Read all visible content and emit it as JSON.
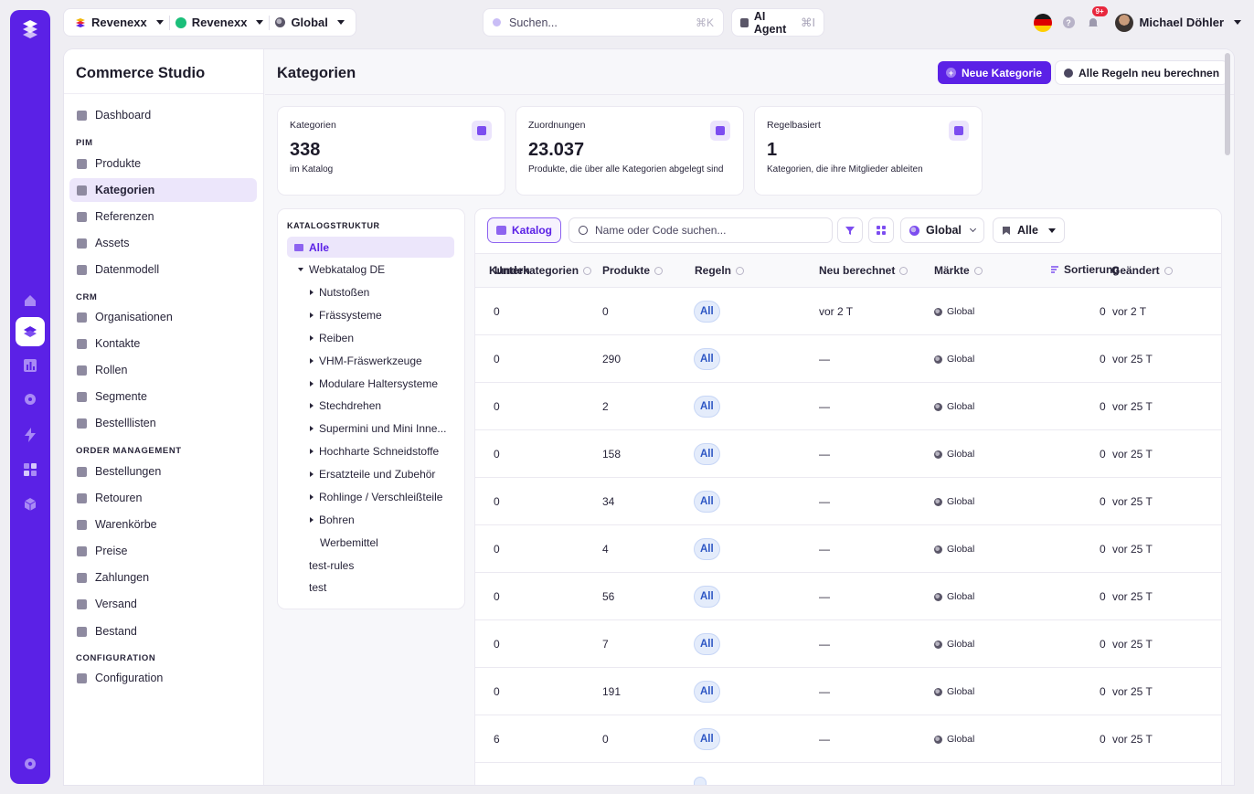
{
  "topbar": {
    "org1": "Revenexx",
    "org2": "Revenexx",
    "scope": "Global",
    "search_placeholder": "Suchen...",
    "search_shortcut": "⌘K",
    "agent_label": "AI Agent",
    "agent_shortcut": "⌘I",
    "notif_count": "9+",
    "user_name": "Michael Döhler"
  },
  "sidebar": {
    "title": "Commerce Studio",
    "dashboard": "Dashboard",
    "sections": {
      "pim": "PIM",
      "crm": "CRM",
      "order": "ORDER MANAGEMENT",
      "config": "CONFIGURATION"
    },
    "items": {
      "produkte": "Produkte",
      "kategorien": "Kategorien",
      "referenzen": "Referenzen",
      "assets": "Assets",
      "datenmodell": "Datenmodell",
      "organisationen": "Organisationen",
      "kontakte": "Kontakte",
      "rollen": "Rollen",
      "segmente": "Segmente",
      "bestelllisten": "Bestelllisten",
      "bestellungen": "Bestellungen",
      "retouren": "Retouren",
      "warenkoerbe": "Warenkörbe",
      "preise": "Preise",
      "zahlungen": "Zahlungen",
      "versand": "Versand",
      "bestand": "Bestand",
      "configuration": "Configuration"
    }
  },
  "page": {
    "title": "Kategorien",
    "new_button": "Neue Kategorie",
    "recalc_button": "Alle Regeln neu berechnen"
  },
  "stats": [
    {
      "label": "Kategorien",
      "value": "338",
      "sub": "im Katalog"
    },
    {
      "label": "Zuordnungen",
      "value": "23.037",
      "sub": "Produkte, die über alle Kategorien abgelegt sind"
    },
    {
      "label": "Regelbasiert",
      "value": "1",
      "sub": "Kategorien, die ihre Mitglieder ableiten"
    }
  ],
  "tree": {
    "heading": "KATALOGSTRUKTUR",
    "all": "Alle",
    "root": "Webkatalog DE",
    "children": [
      "Nutstoßen",
      "Frässysteme",
      "Reiben",
      "VHM-Fräswerkzeuge",
      "Modulare Haltersysteme",
      "Stechdrehen",
      "Supermini und Mini Inne...",
      "Hochharte Schneidstoffe",
      "Ersatzteile und Zubehör",
      "Rohlinge / Verschleißteile",
      "Bohren",
      "Werbemittel"
    ],
    "others": [
      "test-rules",
      "test"
    ]
  },
  "toolbar": {
    "tab": "Katalog",
    "search_placeholder": "Name oder Code suchen...",
    "market": "Global",
    "filter": "Alle"
  },
  "table": {
    "headers": {
      "col1a": "Kunden",
      "col1b": "Unterkategorien",
      "produkte": "Produkte",
      "regeln": "Regeln",
      "neu": "Neu berechnet",
      "maerkte": "Märkte",
      "sortierung": "Sortierung",
      "geaendert": "Geändert"
    },
    "rows": [
      {
        "sub": "0",
        "produkte": "0",
        "regeln": "All",
        "neu": "vor 2 T",
        "markt": "Global",
        "sort": "0",
        "geaendert": "vor 2 T"
      },
      {
        "sub": "0",
        "produkte": "290",
        "regeln": "All",
        "neu": "—",
        "markt": "Global",
        "sort": "0",
        "geaendert": "vor 25 T"
      },
      {
        "sub": "0",
        "produkte": "2",
        "regeln": "All",
        "neu": "—",
        "markt": "Global",
        "sort": "0",
        "geaendert": "vor 25 T"
      },
      {
        "sub": "0",
        "produkte": "158",
        "regeln": "All",
        "neu": "—",
        "markt": "Global",
        "sort": "0",
        "geaendert": "vor 25 T"
      },
      {
        "sub": "0",
        "produkte": "34",
        "regeln": "All",
        "neu": "—",
        "markt": "Global",
        "sort": "0",
        "geaendert": "vor 25 T"
      },
      {
        "sub": "0",
        "produkte": "4",
        "regeln": "All",
        "neu": "—",
        "markt": "Global",
        "sort": "0",
        "geaendert": "vor 25 T"
      },
      {
        "sub": "0",
        "produkte": "56",
        "regeln": "All",
        "neu": "—",
        "markt": "Global",
        "sort": "0",
        "geaendert": "vor 25 T"
      },
      {
        "sub": "0",
        "produkte": "7",
        "regeln": "All",
        "neu": "—",
        "markt": "Global",
        "sort": "0",
        "geaendert": "vor 25 T"
      },
      {
        "sub": "0",
        "produkte": "191",
        "regeln": "All",
        "neu": "—",
        "markt": "Global",
        "sort": "0",
        "geaendert": "vor 25 T"
      },
      {
        "sub": "6",
        "produkte": "0",
        "regeln": "All",
        "neu": "—",
        "markt": "Global",
        "sort": "0",
        "geaendert": "vor 25 T"
      }
    ]
  }
}
